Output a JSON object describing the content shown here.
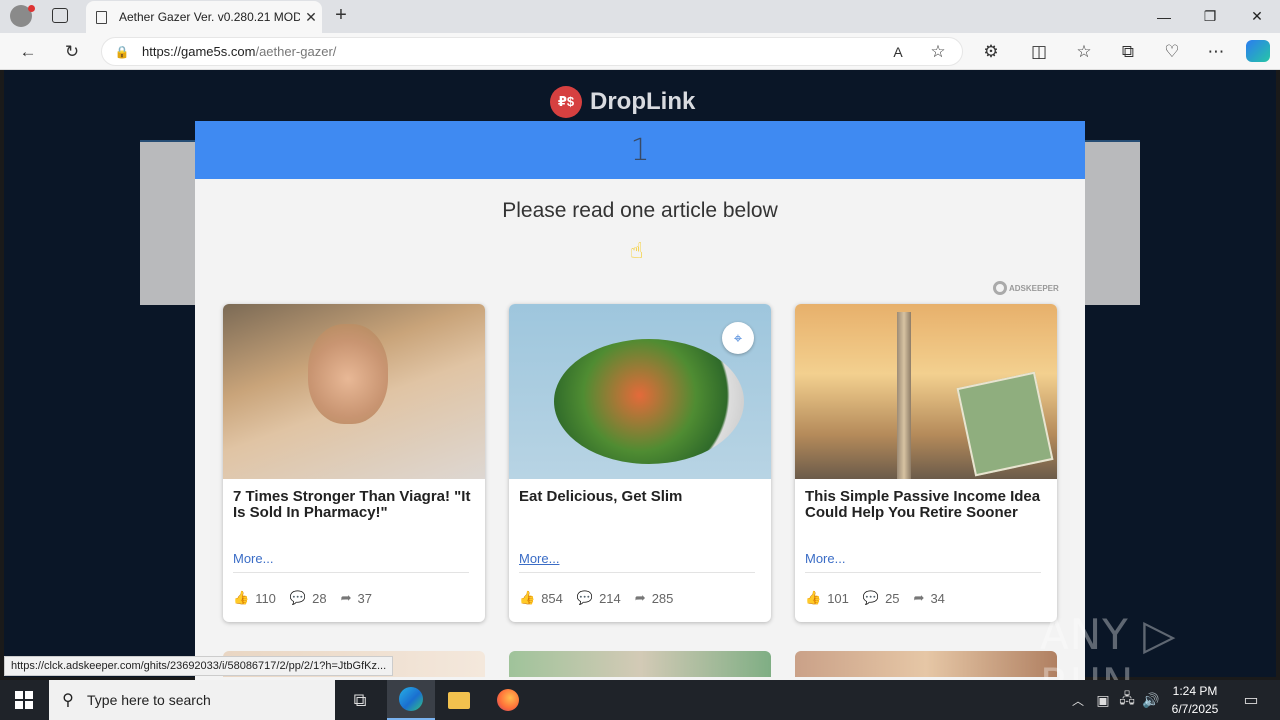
{
  "browser": {
    "tab_title": "Aether Gazer Ver. v0.280.21 MOD",
    "url_domain": "https://game5s.com",
    "url_path": "/aether-gazer/",
    "status_url": "https://clck.adskeeper.com/ghits/23692033/i/58086717/2/pp/2/1?h=JtbGfKz..."
  },
  "page": {
    "logo_text": "DropLink",
    "logo_badge": "₽$",
    "counter": "1",
    "heading": "Please read one article below",
    "ad_brand": "ADSKEEPER",
    "cards": [
      {
        "title": "7 Times Stronger Than Viagra! \"It Is Sold In Pharmacy!\"",
        "more": "More...",
        "likes": "110",
        "comments": "28",
        "shares": "37"
      },
      {
        "title": "Eat Delicious, Get Slim",
        "more": "More...",
        "likes": "854",
        "comments": "214",
        "shares": "285"
      },
      {
        "title": "This Simple Passive Income Idea Could Help You Retire Sooner",
        "more": "More...",
        "likes": "101",
        "comments": "25",
        "shares": "34"
      }
    ],
    "watermark": "ANY ▷ RUN"
  },
  "taskbar": {
    "search_placeholder": "Type here to search",
    "time": "1:24 PM",
    "date": "6/7/2025"
  }
}
